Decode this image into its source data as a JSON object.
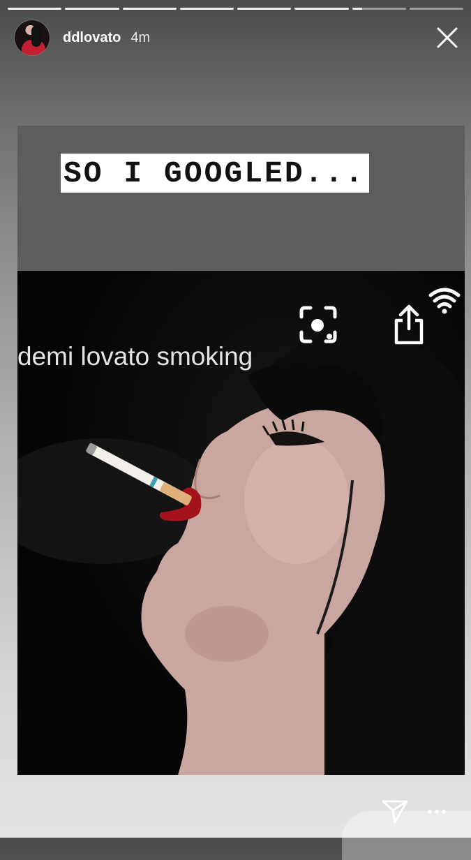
{
  "progress": {
    "total_segments": 8,
    "completed_segments": 6,
    "current_segment_progress": 0.18
  },
  "header": {
    "username": "ddlovato",
    "time_ago": "4m"
  },
  "story": {
    "caption": "SO I GOOGLED...",
    "search_query": "demi lovato smoking"
  },
  "colors": {
    "lipstick": "#a4121c",
    "caption_bg": "#ffffff",
    "search_bar_bg": "#5d5d5d"
  },
  "icons": [
    "close-icon",
    "wifi-icon",
    "lens-icon",
    "share-icon",
    "send-icon",
    "more-icon"
  ]
}
